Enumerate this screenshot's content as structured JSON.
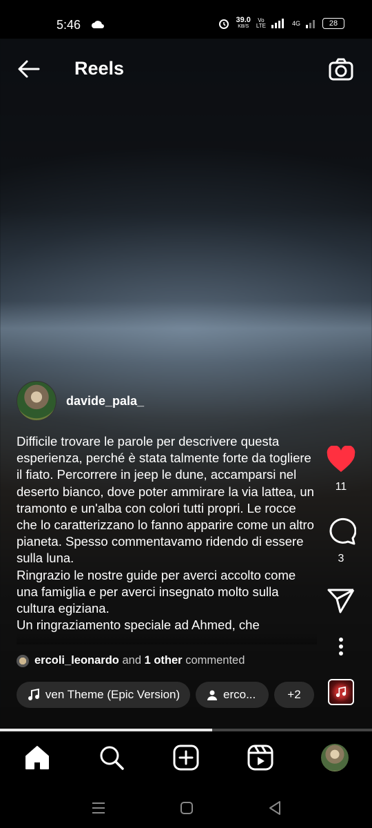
{
  "status_bar": {
    "time": "5:46",
    "speed": "39.0",
    "speed_unit": "KB/S",
    "volte": "Vo",
    "lte": "LTE",
    "network": "4G",
    "battery": "28"
  },
  "header": {
    "title": "Reels"
  },
  "post": {
    "username": "davide_pala_",
    "caption": "Difficile trovare le parole per descrivere questa esperienza, perché è stata talmente forte da togliere il fiato. Percorrere in jeep le dune, accamparsi nel deserto bianco, dove poter ammirare la via lattea, un tramonto e un'alba con colori tutti propri. Le rocce che lo caratterizzano lo fanno apparire come un altro pianeta. Spesso commentavamo ridendo di essere sulla luna.\nRingrazio le nostre guide per averci accolto come una famiglia e per averci insegnato molto sulla cultura egiziana.\nUn ringraziamento speciale ad Ahmed, che",
    "commented": {
      "user": "ercoli_leonardo",
      "and": "and",
      "other": "1 other",
      "suffix": "commented"
    },
    "chips": {
      "music": "ven Theme (Epic Version)",
      "person": "erco...",
      "more": "+2"
    },
    "likes": "11",
    "comments": "3",
    "progress": 0.57
  },
  "icons": {
    "back": "arrow-left-icon",
    "camera": "camera-icon",
    "like": "heart-icon",
    "comment": "comment-icon",
    "share": "send-icon",
    "more": "more-vertical-icon",
    "music": "music-note-icon",
    "home": "home-icon",
    "search": "search-icon",
    "create": "plus-square-icon",
    "reels": "reels-icon",
    "profile": "avatar-icon"
  },
  "colors": {
    "like": "#ff3040",
    "background": "#000000"
  }
}
